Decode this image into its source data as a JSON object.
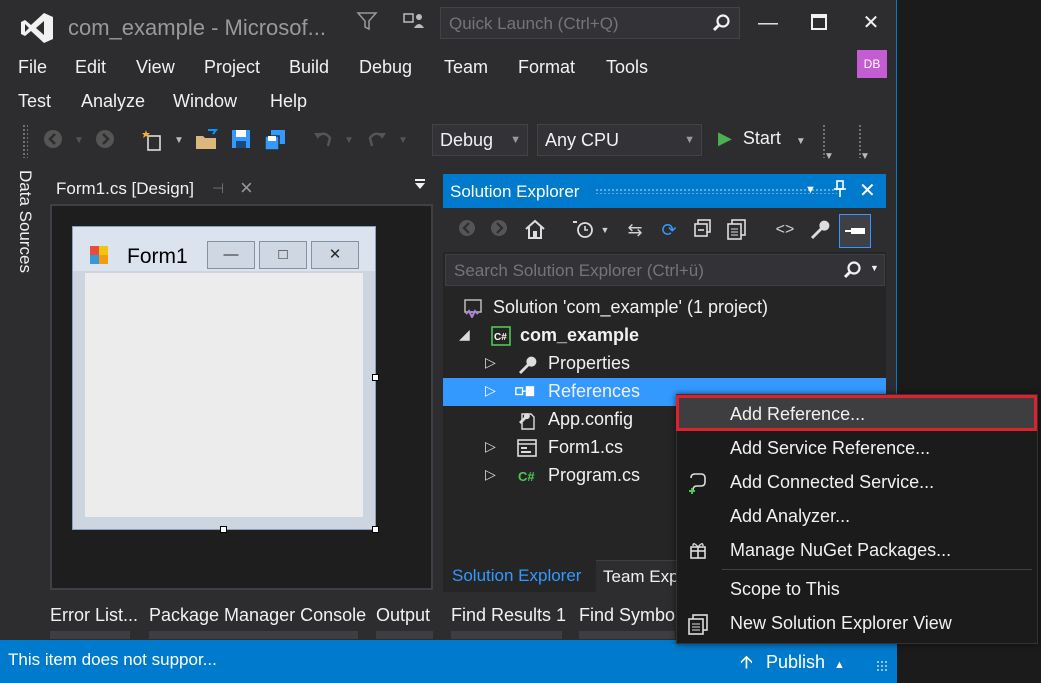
{
  "window": {
    "title": "com_example - Microsof...",
    "quick_launch_placeholder": "Quick Launch (Ctrl+Q)",
    "user_initials": "DB",
    "colors": {
      "accent": "#007acc",
      "selection": "#3399ff",
      "highlight_frame": "#e0202a",
      "avatar": "#c45cd2"
    }
  },
  "menu": {
    "row1": [
      "File",
      "Edit",
      "View",
      "Project",
      "Build",
      "Debug",
      "Team",
      "Format",
      "Tools"
    ],
    "row2": [
      "Test",
      "Analyze",
      "Window",
      "Help"
    ]
  },
  "toolbar": {
    "config": "Debug",
    "platform": "Any CPU",
    "start_label": "Start"
  },
  "left_tab": {
    "label": "Data Sources"
  },
  "document": {
    "tab_label": "Form1.cs [Design]",
    "form_title": "Form1"
  },
  "solution_explorer": {
    "title": "Solution Explorer",
    "search_placeholder": "Search Solution Explorer (Ctrl+ü)",
    "tree": {
      "solution": "Solution 'com_example' (1 project)",
      "project": "com_example",
      "properties": "Properties",
      "references": "References",
      "appconfig": "App.config",
      "form1": "Form1.cs",
      "program": "Program.cs"
    },
    "tabs": [
      "Solution Explorer",
      "Team Exp"
    ]
  },
  "bottom_tabs": [
    "Error List...",
    "Package Manager Console",
    "Output",
    "Find Results 1",
    "Find Symbo"
  ],
  "status": {
    "message": "This item does not suppor...",
    "publish": "Publish"
  },
  "context_menu": {
    "items": [
      {
        "label": "Add Reference...",
        "icon": ""
      },
      {
        "label": "Add Service Reference...",
        "icon": ""
      },
      {
        "label": "Add Connected Service...",
        "icon": "connected-service-icon"
      },
      {
        "label": "Add Analyzer...",
        "icon": ""
      },
      {
        "label": "Manage NuGet Packages...",
        "icon": "nuget-icon"
      },
      {
        "label": "Scope to This",
        "icon": ""
      },
      {
        "label": "New Solution Explorer View",
        "icon": "new-view-icon"
      }
    ]
  }
}
